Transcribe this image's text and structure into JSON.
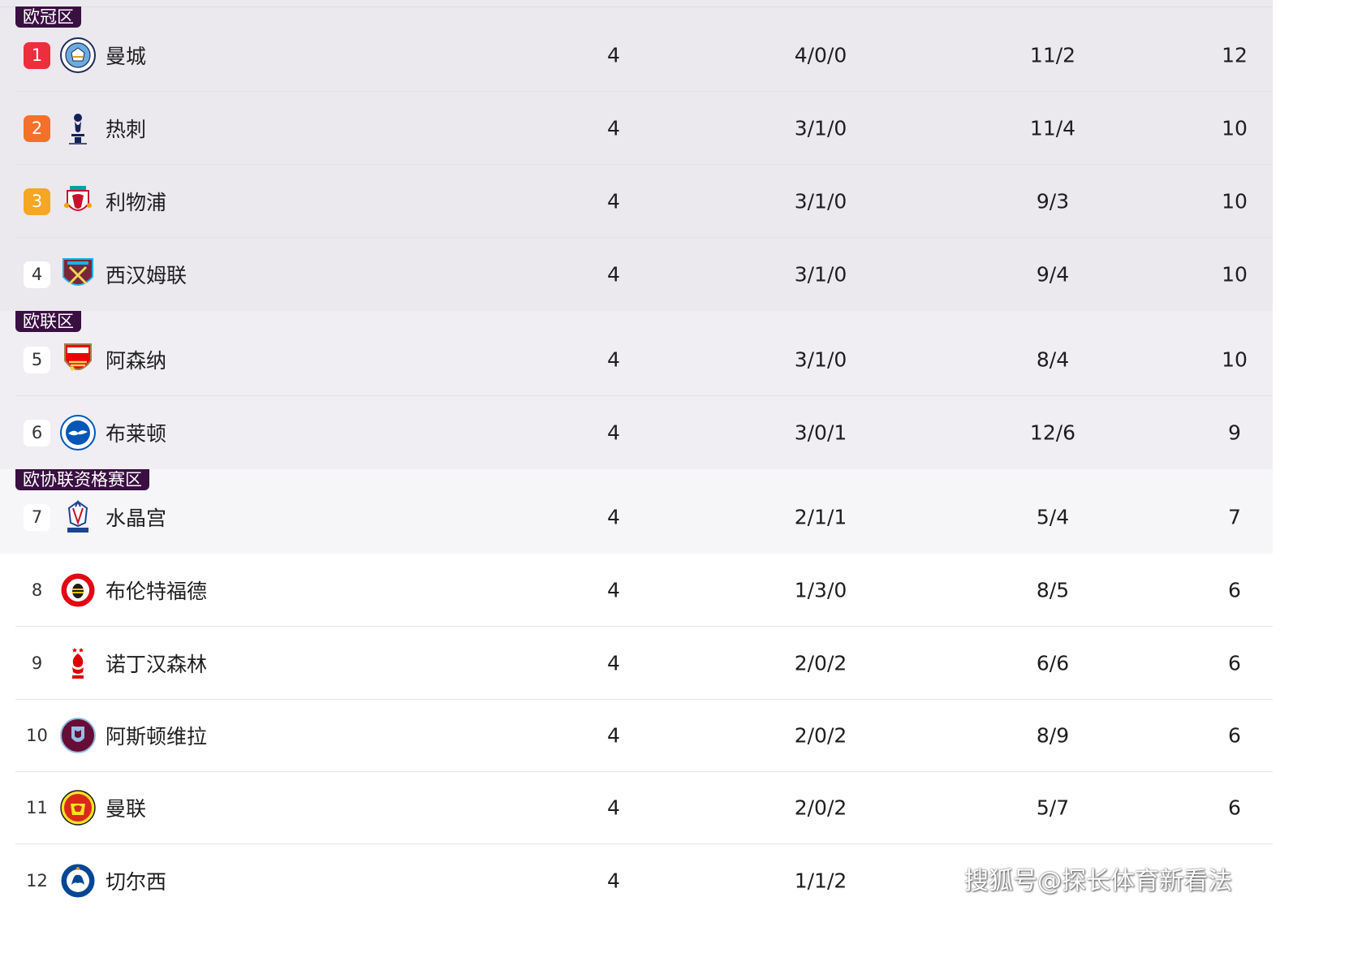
{
  "zones": {
    "ucl": "欧冠区",
    "uel": "欧联区",
    "uecl": "欧协联资格赛区"
  },
  "colors": {
    "ucl_band": "#ebe8ee",
    "uel_band": "#f0eef3",
    "uecl_band": "#f6f5f8",
    "tag_bg": "#3a0f42",
    "rank1": "#ee2e3c",
    "rank2": "#f4702b",
    "rank3": "#f5a623"
  },
  "rows": [
    {
      "rank": "1",
      "team": "曼城",
      "crest": "man-city-crest-icon",
      "played": "4",
      "wdl": "4/0/0",
      "goals": "11/2",
      "points": "12"
    },
    {
      "rank": "2",
      "team": "热刺",
      "crest": "tottenham-crest-icon",
      "played": "4",
      "wdl": "3/1/0",
      "goals": "11/4",
      "points": "10"
    },
    {
      "rank": "3",
      "team": "利物浦",
      "crest": "liverpool-crest-icon",
      "played": "4",
      "wdl": "3/1/0",
      "goals": "9/3",
      "points": "10"
    },
    {
      "rank": "4",
      "team": "西汉姆联",
      "crest": "west-ham-crest-icon",
      "played": "4",
      "wdl": "3/1/0",
      "goals": "9/4",
      "points": "10"
    },
    {
      "rank": "5",
      "team": "阿森纳",
      "crest": "arsenal-crest-icon",
      "played": "4",
      "wdl": "3/1/0",
      "goals": "8/4",
      "points": "10"
    },
    {
      "rank": "6",
      "team": "布莱顿",
      "crest": "brighton-crest-icon",
      "played": "4",
      "wdl": "3/0/1",
      "goals": "12/6",
      "points": "9"
    },
    {
      "rank": "7",
      "team": "水晶宫",
      "crest": "crystal-palace-crest-icon",
      "played": "4",
      "wdl": "2/1/1",
      "goals": "5/4",
      "points": "7"
    },
    {
      "rank": "8",
      "team": "布伦特福德",
      "crest": "brentford-crest-icon",
      "played": "4",
      "wdl": "1/3/0",
      "goals": "8/5",
      "points": "6"
    },
    {
      "rank": "9",
      "team": "诺丁汉森林",
      "crest": "nottingham-forest-crest-icon",
      "played": "4",
      "wdl": "2/0/2",
      "goals": "6/6",
      "points": "6"
    },
    {
      "rank": "10",
      "team": "阿斯顿维拉",
      "crest": "aston-villa-crest-icon",
      "played": "4",
      "wdl": "2/0/2",
      "goals": "8/9",
      "points": "6"
    },
    {
      "rank": "11",
      "team": "曼联",
      "crest": "man-united-crest-icon",
      "played": "4",
      "wdl": "2/0/2",
      "goals": "5/7",
      "points": "6"
    },
    {
      "rank": "12",
      "team": "切尔西",
      "crest": "chelsea-crest-icon",
      "played": "4",
      "wdl": "1/1/2",
      "goals": "",
      "points": ""
    }
  ],
  "watermark": "搜狐号@探长体育新看法"
}
